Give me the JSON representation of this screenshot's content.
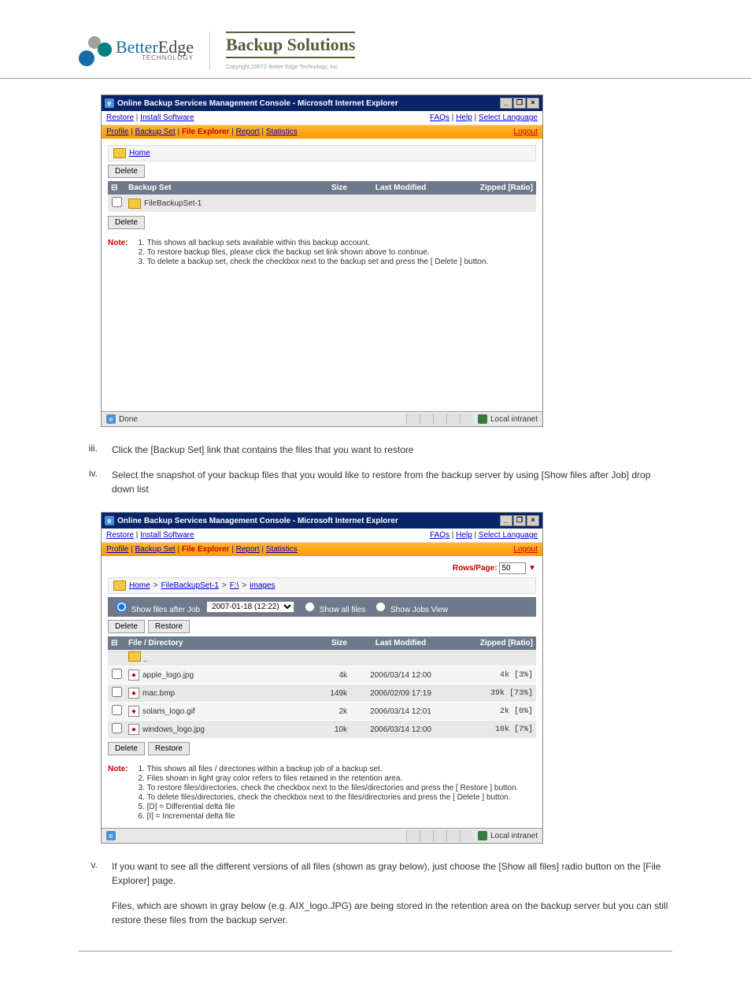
{
  "header": {
    "logo_main": "BetterEdge",
    "logo_sub": "TECHNOLOGY",
    "bs_title": "Backup Solutions",
    "copyright": "Copyright 2007©\nBetter Edge Technology, Inc."
  },
  "screenshot1": {
    "title": "Online Backup Services Management Console - Microsoft Internet Explorer",
    "nav_left": {
      "restore": "Restore",
      "install": "Install Software"
    },
    "nav_right": {
      "faqs": "FAQs",
      "help": "Help",
      "lang": "Select Language"
    },
    "tabs": {
      "profile": "Profile",
      "backup": "Backup Set",
      "file": "File Explorer",
      "report": "Report",
      "stats": "Statistics",
      "logout": "Logout"
    },
    "home": "Home",
    "delete": "Delete",
    "table_headers": {
      "bs": "Backup Set",
      "size": "Size",
      "mod": "Last Modified",
      "zip": "Zipped [Ratio]"
    },
    "row1": "FileBackupSet-1",
    "note_label": "Note:",
    "notes": [
      "This shows all backup sets available within this backup account.",
      "To restore backup files, please click the backup set link shown above to continue.",
      "To delete a backup set, check the checkbox next to the backup set and press the [ Delete ] button."
    ],
    "status_left": "Done",
    "status_right": "Local intranet"
  },
  "instr_iii": {
    "num": "iii.",
    "text": "Click the [Backup Set] link that contains the files that you want to restore"
  },
  "instr_iv": {
    "num": "iv.",
    "text": "Select the snapshot of your backup files that you would like to restore from the backup server by using [Show files after Job] drop down list"
  },
  "screenshot2": {
    "title": "Online Backup Services Management Console - Microsoft Internet Explorer",
    "rows_label": "Rows/Page:",
    "rows_val": "50",
    "breadcrumb": {
      "home": "Home",
      "set": "FileBackupSet-1",
      "drive": "F:\\",
      "folder": "images"
    },
    "filter": {
      "opt1": "Show files after Job",
      "job_val": "2007-01-18 (12:22)",
      "opt2": "Show all files",
      "opt3": "Show Jobs View"
    },
    "delete": "Delete",
    "restore": "Restore",
    "table_headers": {
      "fd": "File / Directory",
      "size": "Size",
      "mod": "Last Modified",
      "zip": "Zipped [Ratio]"
    },
    "files": [
      {
        "name": "apple_logo.jpg",
        "size": "4k",
        "mod": "2006/03/14 12:00",
        "zip": "4k [3%]"
      },
      {
        "name": "mac.bmp",
        "size": "149k",
        "mod": "2006/02/09 17:19",
        "zip": "39k [73%]"
      },
      {
        "name": "solaris_logo.gif",
        "size": "2k",
        "mod": "2006/03/14 12:01",
        "zip": "2k [0%]"
      },
      {
        "name": "windows_logo.jpg",
        "size": "10k",
        "mod": "2006/03/14 12:00",
        "zip": "10k [7%]"
      }
    ],
    "note_label": "Note:",
    "notes": [
      "This shows all files / directories within a backup job of a backup set.",
      "Files shown in light gray color refers to files retained in the retention area.",
      "To restore files/directories, check the checkbox next to the files/directories and press the [ Restore ] button.",
      "To delete files/directories, check the checkbox next to the files/directories and press the [ Delete ] button.",
      "[D] = Differential delta file",
      "[I] = Incremental delta file"
    ],
    "status_right": "Local intranet"
  },
  "instr_v": {
    "num": "v.",
    "text": "If you want to see all the different versions of all files (shown as gray below), just choose the [Show all files] radio button on the [File Explorer] page.",
    "cont": "Files, which are shown in gray below (e.g. AIX_logo.JPG) are being stored in the retention area on the backup server but you can still restore these files from the backup server."
  }
}
